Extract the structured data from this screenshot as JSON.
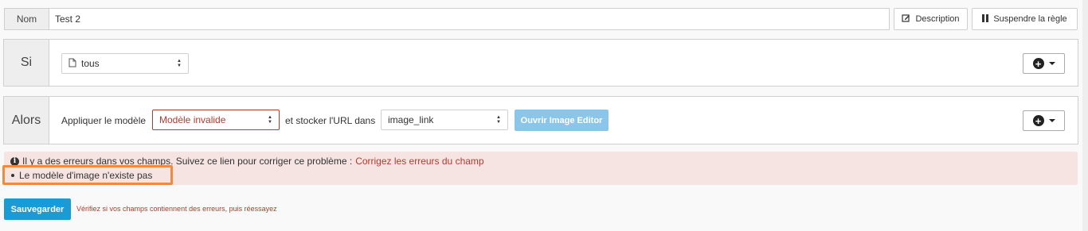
{
  "name_row": {
    "label": "Nom",
    "value": "Test 2"
  },
  "toolbar": {
    "description_label": "Description",
    "suspend_label": "Suspendre la règle"
  },
  "si": {
    "label": "Si",
    "select_value": "tous"
  },
  "alors": {
    "label": "Alors",
    "apply_label": "Appliquer le modèle",
    "model_select_value": "Modèle invalide",
    "store_label": "et stocker l'URL dans",
    "url_select_value": "image_link",
    "image_editor_label": "Ouvrir Image Editor"
  },
  "error": {
    "message": "Il y a des erreurs dans vos champs. Suivez ce lien pour corriger ce problème :",
    "link_label": "Corrigez les erreurs du champ",
    "items": [
      "Le modèle d'image n'existe pas"
    ]
  },
  "footer": {
    "save_label": "Sauvegarder",
    "hint": "Vérifiez si vos champs contiennent des erreurs, puis réessayez"
  },
  "colors": {
    "error_red": "#b33a2e",
    "primary_blue": "#1a9bd5",
    "disabled_blue": "#8bc6ea",
    "error_bg": "#f6e4e3",
    "highlight_orange": "#ef8a3e"
  },
  "icons": [
    "edit-icon",
    "pause-icon",
    "file-icon",
    "plus-circle-icon",
    "caret-down-icon",
    "info-icon",
    "select-arrows-icon"
  ]
}
